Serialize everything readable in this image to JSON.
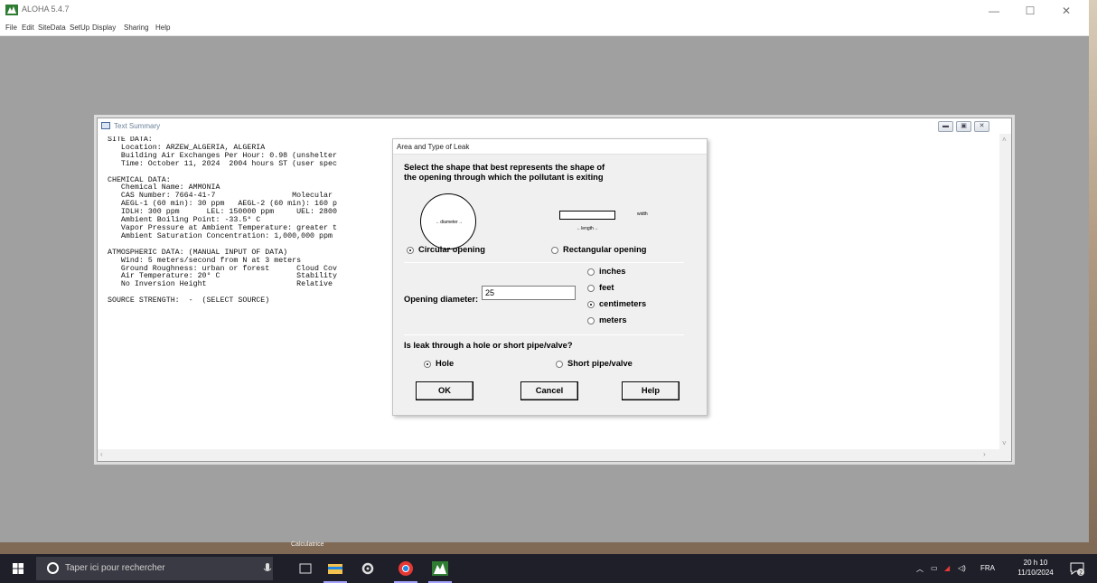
{
  "app": {
    "title": "ALOHA 5.4.7",
    "menu": [
      "File",
      "Edit",
      "SiteData",
      "SetUp",
      "Display",
      "Sharing",
      "Help"
    ]
  },
  "summary_window": {
    "title": "Text Summary",
    "lines": [
      "SITE DATA:",
      "   Location: ARZEW_ALGERIA, ALGERIA",
      "   Building Air Exchanges Per Hour: 0.98 (unshelter",
      "   Time: October 11, 2024  2004 hours ST (user spec",
      "",
      "CHEMICAL DATA:",
      "   Chemical Name: AMMONIA",
      "   CAS Number: 7664-41-7                 Molecular",
      "   AEGL-1 (60 min): 30 ppm   AEGL-2 (60 min): 160 p",
      "   IDLH: 300 ppm      LEL: 150000 ppm     UEL: 2800",
      "   Ambient Boiling Point: -33.5° C",
      "   Vapor Pressure at Ambient Temperature: greater t",
      "   Ambient Saturation Concentration: 1,000,000 ppm",
      "",
      "ATMOSPHERIC DATA: (MANUAL INPUT OF DATA)",
      "   Wind: 5 meters/second from N at 3 meters",
      "   Ground Roughness: urban or forest      Cloud Cov",
      "   Air Temperature: 20° C                 Stability",
      "   No Inversion Height                    Relative",
      "",
      "SOURCE STRENGTH:  -  (SELECT SOURCE)"
    ]
  },
  "leak_dialog": {
    "title": "Area and Type of Leak",
    "prompt_line1": "Select the shape that best represents the shape of",
    "prompt_line2": "the opening through which the pollutant is exiting",
    "diameter_glyph": "diameter",
    "width_glyph": "width",
    "length_glyph": "length",
    "shape_options": [
      {
        "label": "Circular opening",
        "checked": true
      },
      {
        "label": "Rectangular opening",
        "checked": false
      }
    ],
    "diameter_label": "Opening diameter:",
    "diameter_value": "25",
    "unit_options": [
      {
        "label": "inches",
        "checked": false
      },
      {
        "label": "feet",
        "checked": false
      },
      {
        "label": "centimeters",
        "checked": true
      },
      {
        "label": "meters",
        "checked": false
      }
    ],
    "leak_question": "Is leak through a hole or short pipe/valve?",
    "leak_options": [
      {
        "label": "Hole",
        "checked": true
      },
      {
        "label": "Short pipe/valve",
        "checked": false
      }
    ],
    "buttons": {
      "ok": "OK",
      "cancel": "Cancel",
      "help": "Help"
    }
  },
  "taskbar": {
    "search_placeholder": "Taper ici pour rechercher",
    "language": "FRA",
    "time": "20 h 10",
    "date": "11/10/2024",
    "notification_count": "2",
    "thumbnail_caption": "Calculatrice"
  },
  "colors": {
    "workspace": "#a0a0a0",
    "taskbar": "#1f1f2a",
    "dialog_bg": "#f0f0f0"
  }
}
